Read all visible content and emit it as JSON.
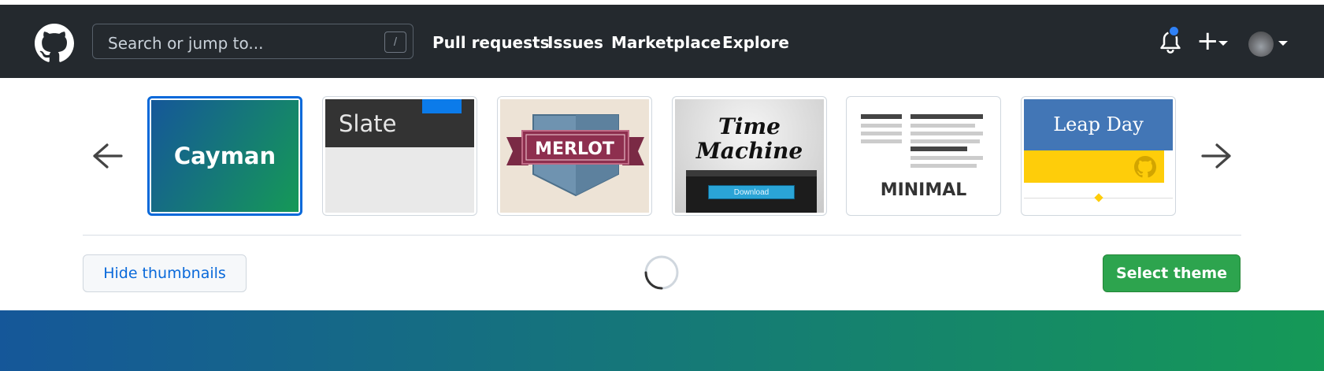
{
  "header": {
    "search_placeholder": "Search or jump to...",
    "search_shortcut": "/",
    "nav": [
      "Pull requests",
      "Issues",
      "Marketplace",
      "Explore"
    ],
    "new_label": "+"
  },
  "themes": {
    "prev_icon": "arrow-left-icon",
    "next_icon": "arrow-right-icon",
    "selected": "Cayman",
    "items": [
      {
        "name": "Cayman",
        "label": "Cayman"
      },
      {
        "name": "Slate",
        "label": "Slate"
      },
      {
        "name": "Merlot",
        "label": "MERLOT"
      },
      {
        "name": "Time Machine",
        "label_line1": "Time",
        "label_line2": "Machine",
        "button": "Download"
      },
      {
        "name": "Minimal",
        "label": "MINIMAL"
      },
      {
        "name": "Leap Day",
        "label": "Leap Day"
      }
    ]
  },
  "actions": {
    "hide_thumbnails": "Hide thumbnails",
    "select_theme": "Select theme"
  },
  "colors": {
    "header_bg": "#24292e",
    "accent_blue": "#0969da",
    "primary_green": "#2da44e",
    "banner_start": "#155799",
    "banner_end": "#159957"
  }
}
